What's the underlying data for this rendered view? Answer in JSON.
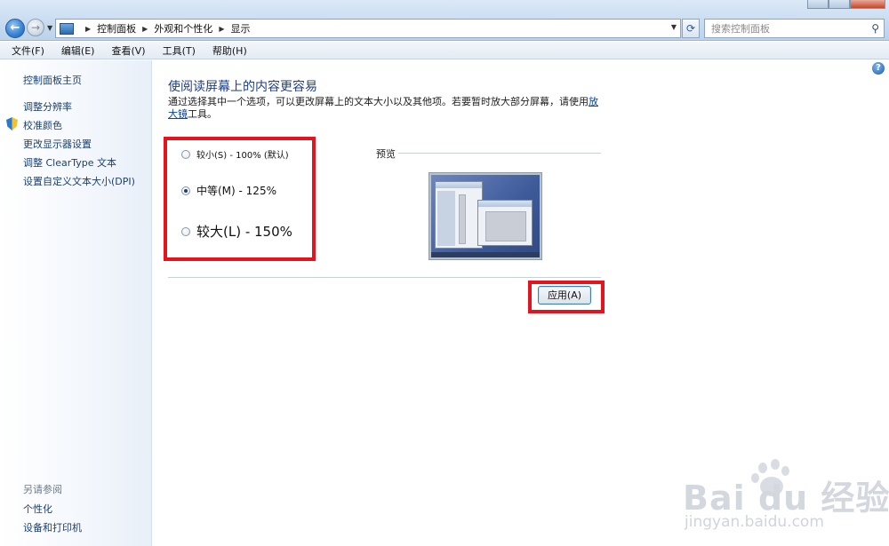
{
  "address_bar": {
    "breadcrumbs": [
      "控制面板",
      "外观和个性化",
      "显示"
    ],
    "search_placeholder": "搜索控制面板"
  },
  "menu": [
    "文件(F)",
    "编辑(E)",
    "查看(V)",
    "工具(T)",
    "帮助(H)"
  ],
  "sidebar": {
    "home": "控制面板主页",
    "links": [
      "调整分辨率",
      "校准颜色",
      "更改显示器设置",
      "调整 ClearType 文本",
      "设置自定义文本大小(DPI)"
    ],
    "see_also_title": "另请参阅",
    "see_also_links": [
      "个性化",
      "设备和打印机"
    ]
  },
  "main": {
    "title": "使阅读屏幕上的内容更容易",
    "description_before": "通过选择其中一个选项，可以更改屏幕上的文本大小以及其他项。若要暂时放大部分屏幕，请使用",
    "description_link": "放大镜",
    "description_after": "工具。",
    "options": [
      {
        "label": "较小(S) - 100% (默认)",
        "checked": false
      },
      {
        "label": "中等(M) - 125%",
        "checked": true
      },
      {
        "label": "较大(L) - 150%",
        "checked": false
      }
    ],
    "preview_label": "预览",
    "apply_button": "应用(A)",
    "help_icon": "?"
  },
  "watermark": {
    "brand": "Bai du 经验",
    "url": "jingyan.baidu.com"
  },
  "colors": {
    "highlight_box": "#e3141e",
    "link": "#1c3f6f",
    "title": "#1e3e8a"
  }
}
